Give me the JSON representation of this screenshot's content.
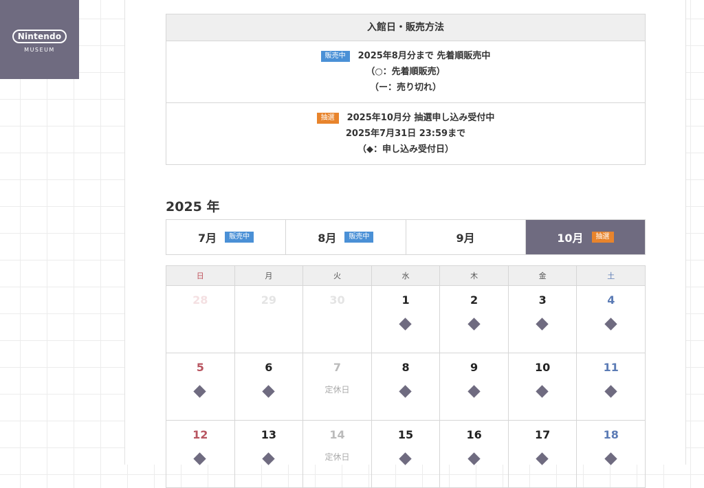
{
  "logo": {
    "brand": "Nintendo",
    "sub": "MUSEUM"
  },
  "info": {
    "header": "入館日・販売方法",
    "sale": {
      "badge": "販売中",
      "line1": "2025年8月分まで 先着順販売中",
      "line2": "（○：先着順販売）",
      "line3": "（ー：売り切れ）"
    },
    "lottery": {
      "badge": "抽選",
      "line1": "2025年10月分 抽選申し込み受付中",
      "line2": "2025年7月31日 23:59まで",
      "line3": "（◆：申し込み受付日）"
    }
  },
  "year_label": "2025 年",
  "tabs": [
    {
      "label": "7月",
      "badge": "販売中"
    },
    {
      "label": "8月",
      "badge": "販売中"
    },
    {
      "label": "9月",
      "badge": ""
    },
    {
      "label": "10月",
      "badge": "抽選"
    }
  ],
  "weekdays": [
    "日",
    "月",
    "火",
    "水",
    "木",
    "金",
    "土"
  ],
  "weeks": [
    [
      {
        "day": "28",
        "state": "faded"
      },
      {
        "day": "29",
        "state": "faded"
      },
      {
        "day": "30",
        "state": "faded"
      },
      {
        "day": "1",
        "state": "lottery"
      },
      {
        "day": "2",
        "state": "lottery"
      },
      {
        "day": "3",
        "state": "lottery"
      },
      {
        "day": "4",
        "state": "lottery"
      }
    ],
    [
      {
        "day": "5",
        "state": "lottery"
      },
      {
        "day": "6",
        "state": "lottery"
      },
      {
        "day": "7",
        "state": "closed",
        "note": "定休日"
      },
      {
        "day": "8",
        "state": "lottery"
      },
      {
        "day": "9",
        "state": "lottery"
      },
      {
        "day": "10",
        "state": "lottery"
      },
      {
        "day": "11",
        "state": "lottery"
      }
    ],
    [
      {
        "day": "12",
        "state": "lottery"
      },
      {
        "day": "13",
        "state": "lottery"
      },
      {
        "day": "14",
        "state": "closed",
        "note": "定休日"
      },
      {
        "day": "15",
        "state": "lottery"
      },
      {
        "day": "16",
        "state": "lottery"
      },
      {
        "day": "17",
        "state": "lottery"
      },
      {
        "day": "18",
        "state": "lottery"
      }
    ]
  ],
  "colors": {
    "accent": "#6f6b80",
    "sale_badge": "#4a90d6",
    "lottery_badge": "#e8842c",
    "sunday": "#b85560",
    "saturday": "#5b7bb5"
  }
}
